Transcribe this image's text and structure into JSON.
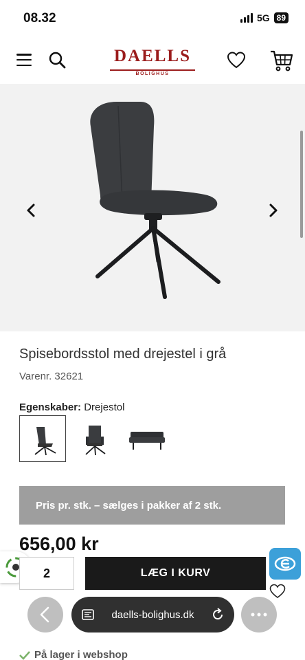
{
  "status": {
    "time": "08.32",
    "network": "5G",
    "battery": "89"
  },
  "header": {
    "logo_main": "DAELLS",
    "logo_sub": "BOLIGHUS"
  },
  "product": {
    "title": "Spisebordsstol med drejestel i grå",
    "sku": "Varenr. 32621",
    "props_label": "Egenskaber:",
    "props_value": "Drejestol",
    "notice": "Pris pr. stk. – sælges i pakker af 2 stk.",
    "price": "656,00 kr",
    "quantity": "2",
    "add_to_cart": "LÆG I KURV",
    "stock": "På lager i webshop"
  },
  "browser": {
    "url": "daells-bolighus.dk"
  },
  "colors": {
    "brand": "#9b1c1c",
    "button": "#1a1a1a",
    "notice_bg": "#9e9e9e",
    "badge": "#3ca0d9"
  }
}
